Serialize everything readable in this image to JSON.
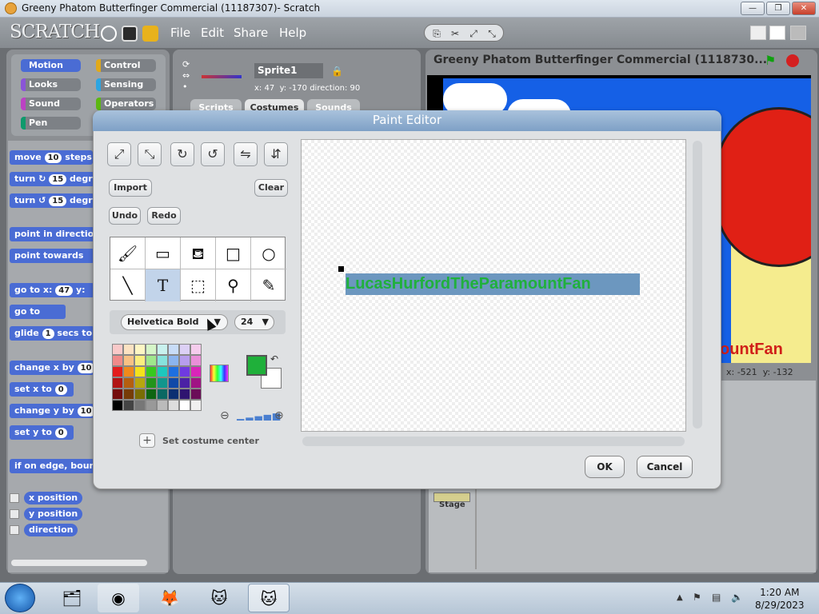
{
  "window": {
    "title": "Greeny Phatom Butterfinger Commercial (11187307)- Scratch",
    "minimize": "—",
    "maximize": "❐",
    "close": "✕"
  },
  "menubar": {
    "logo": "SCRATCH",
    "menus": [
      "File",
      "Edit",
      "Share",
      "Help"
    ]
  },
  "categories": {
    "items": [
      {
        "label": "Motion",
        "color": "#4a6cd4"
      },
      {
        "label": "Control",
        "color": "#e1a91a"
      },
      {
        "label": "Looks",
        "color": "#8a55d7"
      },
      {
        "label": "Sensing",
        "color": "#2ca5e2"
      },
      {
        "label": "Sound",
        "color": "#bb42c3"
      },
      {
        "label": "Operators",
        "color": "#5cb712"
      },
      {
        "label": "Pen",
        "color": "#0e9a6c"
      }
    ]
  },
  "blocks": {
    "move": {
      "pre": "move",
      "val": "10",
      "post": "steps"
    },
    "turn_cw": {
      "pre": "turn ↻",
      "val": "15",
      "post": "degr"
    },
    "turn_ccw": {
      "pre": "turn ↺",
      "val": "15",
      "post": "degr"
    },
    "point_dir": "point in directio",
    "point_towards": "point towards",
    "goto_xy": {
      "pre": "go to x:",
      "val": "47",
      "post": "y:"
    },
    "goto": "go to",
    "glide": {
      "pre": "glide",
      "val": "1",
      "post": "secs to"
    },
    "change_x": {
      "pre": "change x by",
      "val": "10"
    },
    "set_x": {
      "pre": "set x to",
      "val": "0"
    },
    "change_y": {
      "pre": "change y by",
      "val": "10"
    },
    "set_y": {
      "pre": "set y to",
      "val": "0"
    },
    "bounce": "if on edge, bounc",
    "reporters": [
      "x position",
      "y position",
      "direction"
    ]
  },
  "sprite": {
    "name": "Sprite1",
    "x": "x: 47",
    "y": "y: -170",
    "direction": "direction: 90",
    "tabs": [
      "Scripts",
      "Costumes",
      "Sounds"
    ]
  },
  "stage": {
    "title": "Greeny Phatom Butterfinger Commercial (1118730...",
    "overlay_text": "ountFan",
    "mouse_x": "x: -521",
    "mouse_y": "y: -132",
    "stage_label": "Stage"
  },
  "paint_editor": {
    "title": "Paint Editor",
    "import": "Import",
    "clear": "Clear",
    "undo": "Undo",
    "redo": "Redo",
    "font": "Helvetica Bold",
    "font_size": "24",
    "set_center": "Set costume center",
    "canvas_text": "LucasHurfordTheParamountFan",
    "ok": "OK",
    "cancel": "Cancel",
    "fg_color": "#1fb03a",
    "bg_color": "#ffffff",
    "palette": [
      "#f9c9c9",
      "#fbe2c2",
      "#fdf6c4",
      "#d5f5c8",
      "#c9f1ee",
      "#c8dcf7",
      "#dcd0f5",
      "#f5ccec",
      "#f08a8a",
      "#f7c184",
      "#faee7f",
      "#9fe78c",
      "#87e2dd",
      "#8bb4ef",
      "#b79ded",
      "#ea8fd8",
      "#e31d1d",
      "#f08a1b",
      "#f4e21c",
      "#37c81f",
      "#1ec8bd",
      "#1e6fe1",
      "#6f3ae0",
      "#d925b9",
      "#b11414",
      "#b55f0f",
      "#b7a60f",
      "#23941b",
      "#11968d",
      "#1149a8",
      "#4b21a5",
      "#a01484",
      "#740c0c",
      "#763c07",
      "#7a6d05",
      "#0f6512",
      "#0a6863",
      "#0b2f72",
      "#2f1470",
      "#6b0d58",
      "#000000",
      "#444444",
      "#777777",
      "#999999",
      "#bbbbbb",
      "#dddddd",
      "#ffffff",
      "#f0f0f0"
    ]
  },
  "taskbar": {
    "time": "1:20 AM",
    "date": "8/29/2023"
  }
}
